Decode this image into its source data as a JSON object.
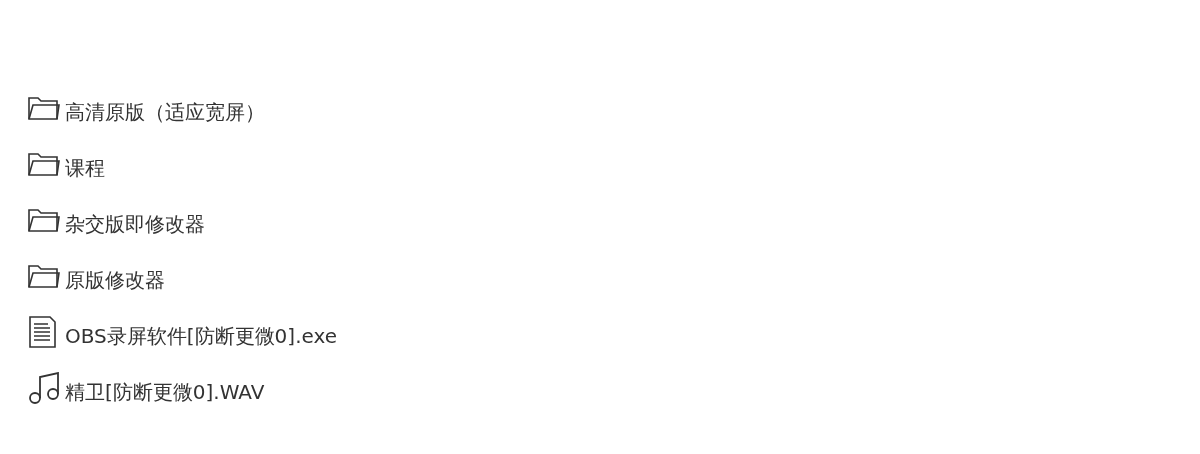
{
  "files": [
    {
      "kind": "folder",
      "name": "高清原版（适应宽屏）"
    },
    {
      "kind": "folder",
      "name": "课程"
    },
    {
      "kind": "folder",
      "name": "杂交版即修改器"
    },
    {
      "kind": "folder",
      "name": "原版修改器"
    },
    {
      "kind": "document",
      "name": "OBS录屏软件[防断更微0].exe"
    },
    {
      "kind": "audio",
      "name": "精卫[防断更微0].WAV"
    }
  ]
}
